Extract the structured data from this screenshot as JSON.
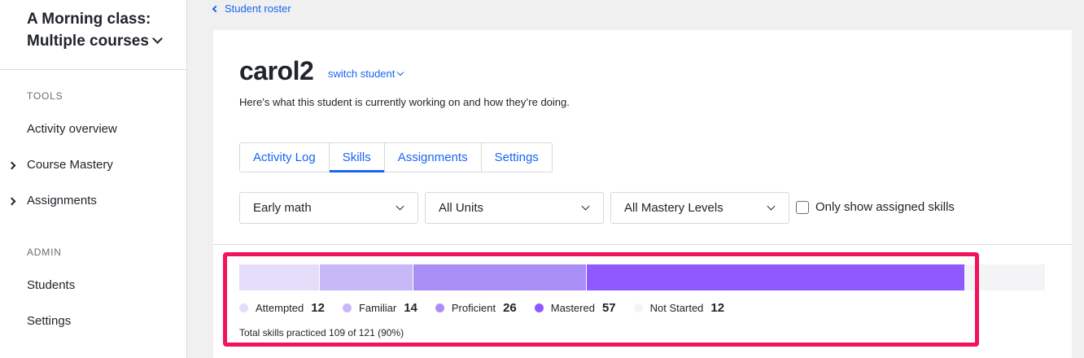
{
  "sidebar": {
    "class_title": "A Morning class: Multiple courses",
    "tools_heading": "TOOLS",
    "tools": [
      {
        "label": "Activity overview"
      },
      {
        "label": "Course Mastery"
      },
      {
        "label": "Assignments"
      }
    ],
    "admin_heading": "ADMIN",
    "admin": [
      {
        "label": "Students"
      },
      {
        "label": "Settings"
      }
    ]
  },
  "breadcrumb": {
    "back_label": "Student roster"
  },
  "student": {
    "name": "carol2",
    "switch_label": "switch student",
    "subtitle": "Here’s what this student is currently working on and how they’re doing."
  },
  "tabs": [
    {
      "label": "Activity Log",
      "active": false
    },
    {
      "label": "Skills",
      "active": true
    },
    {
      "label": "Assignments",
      "active": false
    },
    {
      "label": "Settings",
      "active": false
    }
  ],
  "filters": {
    "course": "Early math",
    "units": "All Units",
    "mastery": "All Mastery Levels",
    "only_assigned_label": "Only show assigned skills",
    "only_assigned_checked": false
  },
  "mastery_summary": {
    "levels": [
      {
        "label": "Attempted",
        "count": "12",
        "color": "#e4defa"
      },
      {
        "label": "Familiar",
        "count": "14",
        "color": "#c9b8f7"
      },
      {
        "label": "Proficient",
        "count": "26",
        "color": "#a98ef6"
      },
      {
        "label": "Mastered",
        "count": "57",
        "color": "#9059ff"
      },
      {
        "label": "Not Started",
        "count": "12",
        "color": "#f4f4f7"
      }
    ],
    "total_text": "Total skills practiced 109 of 121 (90%)"
  },
  "colors": {
    "accent": "#1865f2",
    "highlight": "#f2145a"
  }
}
